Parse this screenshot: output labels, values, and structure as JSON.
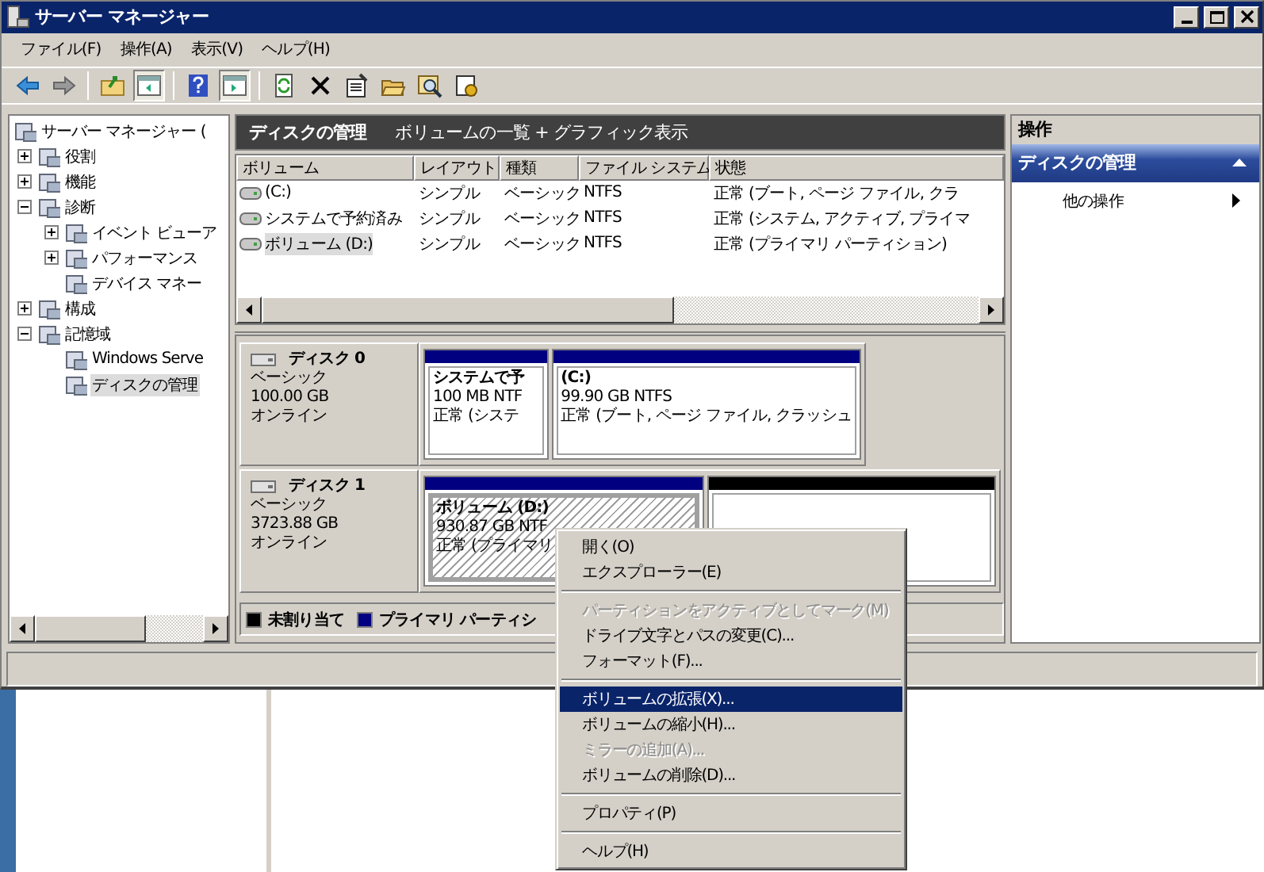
{
  "window": {
    "title": "サーバー マネージャー"
  },
  "menu_bar": [
    {
      "label": "ファイル(F)"
    },
    {
      "label": "操作(A)"
    },
    {
      "label": "表示(V)"
    },
    {
      "label": "ヘルプ(H)"
    }
  ],
  "toolbar": [
    {
      "kind": "back"
    },
    {
      "kind": "forward"
    },
    {
      "kind": "separator"
    },
    {
      "kind": "up"
    },
    {
      "kind": "tree",
      "selected": true
    },
    {
      "kind": "separator"
    },
    {
      "kind": "help"
    },
    {
      "kind": "pane",
      "selected": true
    },
    {
      "kind": "separator"
    },
    {
      "kind": "refresh"
    },
    {
      "kind": "delete"
    },
    {
      "kind": "properties"
    },
    {
      "kind": "open"
    },
    {
      "kind": "find"
    },
    {
      "kind": "settings"
    }
  ],
  "tree": [
    {
      "label": "サーバー マネージャー (",
      "selected": false,
      "children": [
        {
          "label": "役割",
          "expanded": false,
          "selected": false
        },
        {
          "label": "機能",
          "expanded": false,
          "selected": false
        },
        {
          "label": "診断",
          "expanded": true,
          "selected": false,
          "children": [
            {
              "label": "イベント ビューア",
              "expanded": false,
              "selected": false
            },
            {
              "label": "パフォーマンス",
              "expanded": false,
              "selected": false
            },
            {
              "label": "デバイス マネー",
              "selected": false
            }
          ]
        },
        {
          "label": "構成",
          "expanded": false,
          "selected": false
        },
        {
          "label": "記憶域",
          "expanded": true,
          "selected": false,
          "children": [
            {
              "label": "Windows Serve",
              "selected": false
            },
            {
              "label": "ディスクの管理",
              "selected": true
            }
          ]
        }
      ]
    }
  ],
  "center_header": {
    "title": "ディスクの管理",
    "subtitle": "ボリュームの一覧 + グラフィック表示"
  },
  "volume_table": {
    "columns": [
      "ボリューム",
      "レイアウト",
      "種類",
      "ファイル システム",
      "状態"
    ],
    "rows": [
      {
        "cells": [
          "(C:)",
          "シンプル",
          "ベーシック",
          "NTFS",
          "正常 (ブート, ページ ファイル, クラ"
        ],
        "selected": false
      },
      {
        "cells": [
          "システムで予約済み",
          "シンプル",
          "ベーシック",
          "NTFS",
          "正常 (システム, アクティブ, プライマ"
        ],
        "selected": false
      },
      {
        "cells": [
          "ボリューム (D:)",
          "シンプル",
          "ベーシック",
          "NTFS",
          "正常 (プライマリ パーティション)"
        ],
        "selected": true
      }
    ]
  },
  "disks": [
    {
      "name": "ディスク 0",
      "type": "ベーシック",
      "size": "100.00 GB",
      "status": "オンライン",
      "partitions": [
        {
          "kind": "primary",
          "name": "システムで予",
          "size": "100 MB NTF",
          "status": "正常 (システ",
          "selected": false
        },
        {
          "kind": "primary",
          "name": "(C:)",
          "size": "99.90 GB NTFS",
          "status": "正常 (ブート, ページ ファイル, クラッシュ",
          "selected": false
        }
      ]
    },
    {
      "name": "ディスク 1",
      "type": "ベーシック",
      "size": "3723.88 GB",
      "status": "オンライン",
      "partitions": [
        {
          "kind": "primary",
          "name": "ボリューム (D:)",
          "size": "930.87 GB NTF",
          "status": "正常 (プライマリ",
          "selected": true
        },
        {
          "kind": "unallocated",
          "selected": false
        }
      ]
    }
  ],
  "legend": [
    {
      "label": "未割り当て",
      "color": "#000000"
    },
    {
      "label": "プライマリ パーティシ",
      "color": "#000080"
    }
  ],
  "actions": {
    "title": "操作",
    "section": {
      "title": "ディスクの管理",
      "expanded": true
    },
    "items": [
      {
        "label": "他の操作"
      }
    ]
  },
  "context_menu": [
    {
      "kind": "item",
      "label": "開く(O)",
      "disabled": false,
      "selected": false
    },
    {
      "kind": "item",
      "label": "エクスプローラー(E)",
      "disabled": false,
      "selected": false
    },
    {
      "kind": "separator"
    },
    {
      "kind": "item",
      "label": "パーティションをアクティブとしてマーク(M)",
      "disabled": true,
      "selected": false
    },
    {
      "kind": "item",
      "label": "ドライブ文字とパスの変更(C)...",
      "disabled": false,
      "selected": false
    },
    {
      "kind": "item",
      "label": "フォーマット(F)...",
      "disabled": false,
      "selected": false
    },
    {
      "kind": "separator"
    },
    {
      "kind": "item",
      "label": "ボリュームの拡張(X)...",
      "disabled": false,
      "selected": true
    },
    {
      "kind": "item",
      "label": "ボリュームの縮小(H)...",
      "disabled": false,
      "selected": false
    },
    {
      "kind": "item",
      "label": "ミラーの追加(A)...",
      "disabled": true,
      "selected": false
    },
    {
      "kind": "item",
      "label": "ボリュームの削除(D)...",
      "disabled": false,
      "selected": false
    },
    {
      "kind": "separator"
    },
    {
      "kind": "item",
      "label": "プロパティ(P)",
      "disabled": false,
      "selected": false
    },
    {
      "kind": "separator"
    },
    {
      "kind": "item",
      "label": "ヘルプ(H)",
      "disabled": false,
      "selected": false
    }
  ]
}
